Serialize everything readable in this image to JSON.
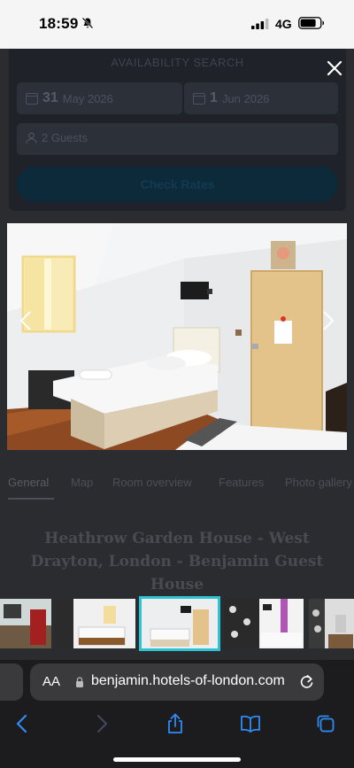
{
  "status_bar": {
    "time": "18:59",
    "network": "4G"
  },
  "availability": {
    "title": "AVAILABILITY SEARCH",
    "checkin_day": "31",
    "checkin_month": "May 2026",
    "checkout_day": "1",
    "checkout_month": "Jun 2026",
    "guests": "2 Guests",
    "button": "Check Rates"
  },
  "tabs": [
    "General",
    "Map",
    "Room overview",
    "Features",
    "Photo gallery"
  ],
  "hotel_title": "Heathrow Garden House - West Drayton, London - Benjamin Guest House",
  "lightbox": {
    "selected_thumbnail": 3,
    "thumbnail_count": 6
  },
  "browser": {
    "aa_label": "AA",
    "url": "benjamin.hotels-of-london.com"
  },
  "colors": {
    "accent": "#2ec3d3",
    "overlay_bg": "#262626",
    "button_dim": "#0d2a3b"
  }
}
